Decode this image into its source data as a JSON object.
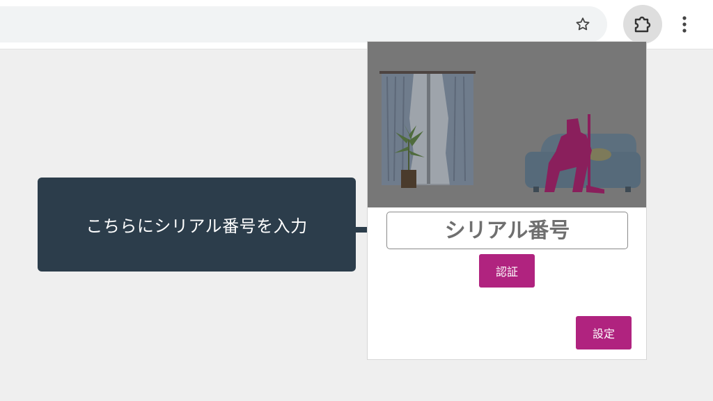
{
  "toolbar": {
    "bookmark_icon": "star-outline-icon",
    "extensions_icon": "puzzle-piece-icon",
    "menu_icon": "vertical-dots-icon"
  },
  "callout": {
    "text": "こちらにシリアル番号を入力"
  },
  "popup": {
    "illustration": "room-illustration",
    "serial_input": {
      "placeholder": "シリアル番号",
      "value": ""
    },
    "auth_button_label": "認証",
    "settings_button_label": "設定"
  },
  "colors": {
    "accent": "#b0237f",
    "callout_bg": "#2c3d4b",
    "overlay_gray": "#777777"
  }
}
